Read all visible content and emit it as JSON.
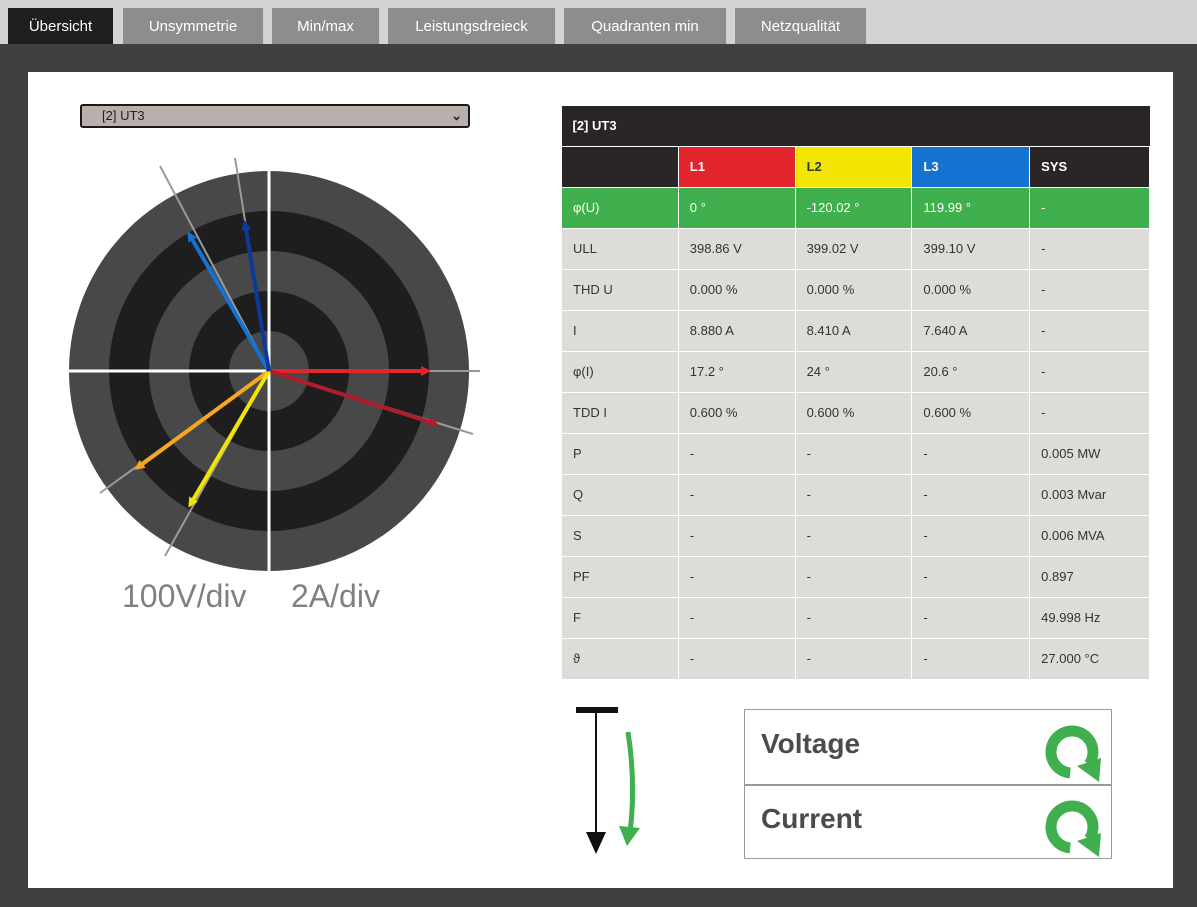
{
  "tabs": [
    {
      "label": "Übersicht",
      "active": true
    },
    {
      "label": "Unsymmetrie",
      "active": false
    },
    {
      "label": "Min/max",
      "active": false
    },
    {
      "label": "Leistungsdreieck",
      "active": false
    },
    {
      "label": "Quadranten min",
      "active": false
    },
    {
      "label": "Netzqualität",
      "active": false
    }
  ],
  "device_select": {
    "value": "[2] UT3"
  },
  "phasor": {
    "voltage_scale": "100V/div",
    "current_scale": "2A/div",
    "colors": {
      "L1": "#e3262d",
      "L2": "#f2e600",
      "L3": "#1473d0",
      "L1_current": "#b01c2e",
      "L2_current": "#f5a623",
      "L3_current": "#0d3a9a"
    }
  },
  "table": {
    "caption": "[2] UT3",
    "columns": [
      "",
      "L1",
      "L2",
      "L3",
      "SYS"
    ],
    "rows": [
      {
        "label": "φ(U)",
        "L1": "0 °",
        "L2": "-120.02 °",
        "L3": "119.99 °",
        "SYS": "-"
      },
      {
        "label": "ULL",
        "L1": "398.86 V",
        "L2": "399.02 V",
        "L3": "399.10 V",
        "SYS": "-"
      },
      {
        "label": "THD U",
        "L1": "0.000 %",
        "L2": "0.000 %",
        "L3": "0.000 %",
        "SYS": "-"
      },
      {
        "label": "I",
        "L1": "8.880 A",
        "L2": "8.410 A",
        "L3": "7.640 A",
        "SYS": "-"
      },
      {
        "label": "φ(I)",
        "L1": "17.2 °",
        "L2": "24 °",
        "L3": "20.6 °",
        "SYS": "-"
      },
      {
        "label": "TDD I",
        "L1": "0.600 %",
        "L2": "0.600 %",
        "L3": "0.600 %",
        "SYS": "-"
      },
      {
        "label": "P",
        "L1": "-",
        "L2": "-",
        "L3": "-",
        "SYS": "0.005 MW"
      },
      {
        "label": "Q",
        "L1": "-",
        "L2": "-",
        "L3": "-",
        "SYS": "0.003 Mvar"
      },
      {
        "label": "S",
        "L1": "-",
        "L2": "-",
        "L3": "-",
        "SYS": "0.006 MVA"
      },
      {
        "label": "PF",
        "L1": "-",
        "L2": "-",
        "L3": "-",
        "SYS": "0.897"
      },
      {
        "label": "F",
        "L1": "-",
        "L2": "-",
        "L3": "-",
        "SYS": "49.998 Hz"
      },
      {
        "label": "ϑ",
        "L1": "-",
        "L2": "-",
        "L3": "-",
        "SYS": "27.000 °C"
      }
    ]
  },
  "rotation": {
    "voltage_label": "Voltage",
    "current_label": "Current",
    "status_color": "#3fb04d"
  }
}
